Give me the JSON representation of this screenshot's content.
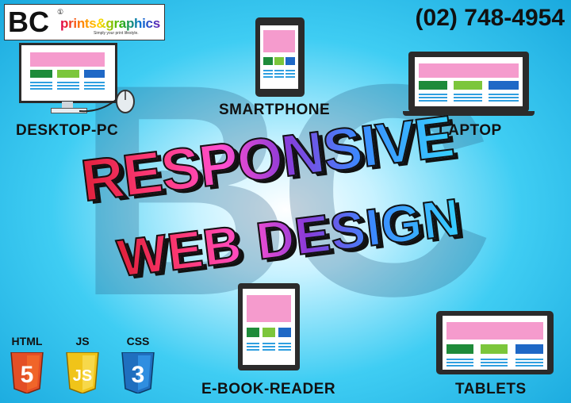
{
  "brand": {
    "logo_letters": "BC",
    "logo_mark": "①",
    "name": "prints&graphics",
    "tagline": "Simply your print lifestyle.",
    "phone": "(02) 748-4954"
  },
  "watermark": "BC",
  "headline": {
    "line1": "RESPONSIVE",
    "line2": "WEB DESIGN"
  },
  "devices": {
    "desktop": "DESKTOP-PC",
    "smartphone": "SMARTPHONE",
    "laptop": "LAPTOP",
    "ereader": "E-BOOK-READER",
    "tablets": "TABLETS"
  },
  "badges": [
    {
      "name": "HTML",
      "digit": "5",
      "color": "#e34f26"
    },
    {
      "name": "JS",
      "digit": "JS",
      "color": "#f0c419"
    },
    {
      "name": "CSS",
      "digit": "3",
      "color": "#1f6fbf"
    }
  ]
}
